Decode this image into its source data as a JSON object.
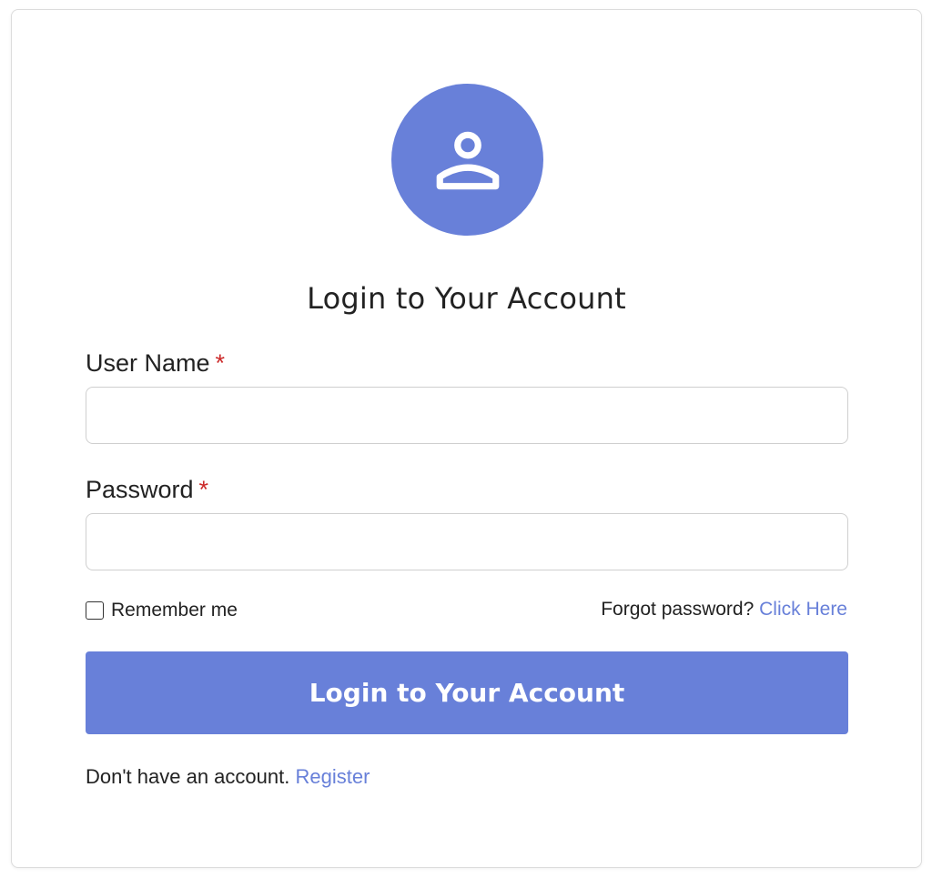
{
  "form": {
    "title": "Login to Your Account",
    "username": {
      "label": "User Name",
      "required_mark": "*",
      "value": "",
      "placeholder": ""
    },
    "password": {
      "label": "Password",
      "required_mark": "*",
      "value": "",
      "placeholder": ""
    },
    "remember_me": {
      "label": "Remember me",
      "checked": false
    },
    "forgot": {
      "text": "Forgot password?",
      "link_label": "Click Here"
    },
    "submit_label": "Login to Your Account",
    "register": {
      "text": "Don't have an account.",
      "link_label": "Register"
    }
  },
  "icons": {
    "avatar": "user-icon"
  },
  "colors": {
    "accent": "#6880d9",
    "required": "#cc2b2b",
    "text": "#222222",
    "border": "#cfcfcf"
  }
}
